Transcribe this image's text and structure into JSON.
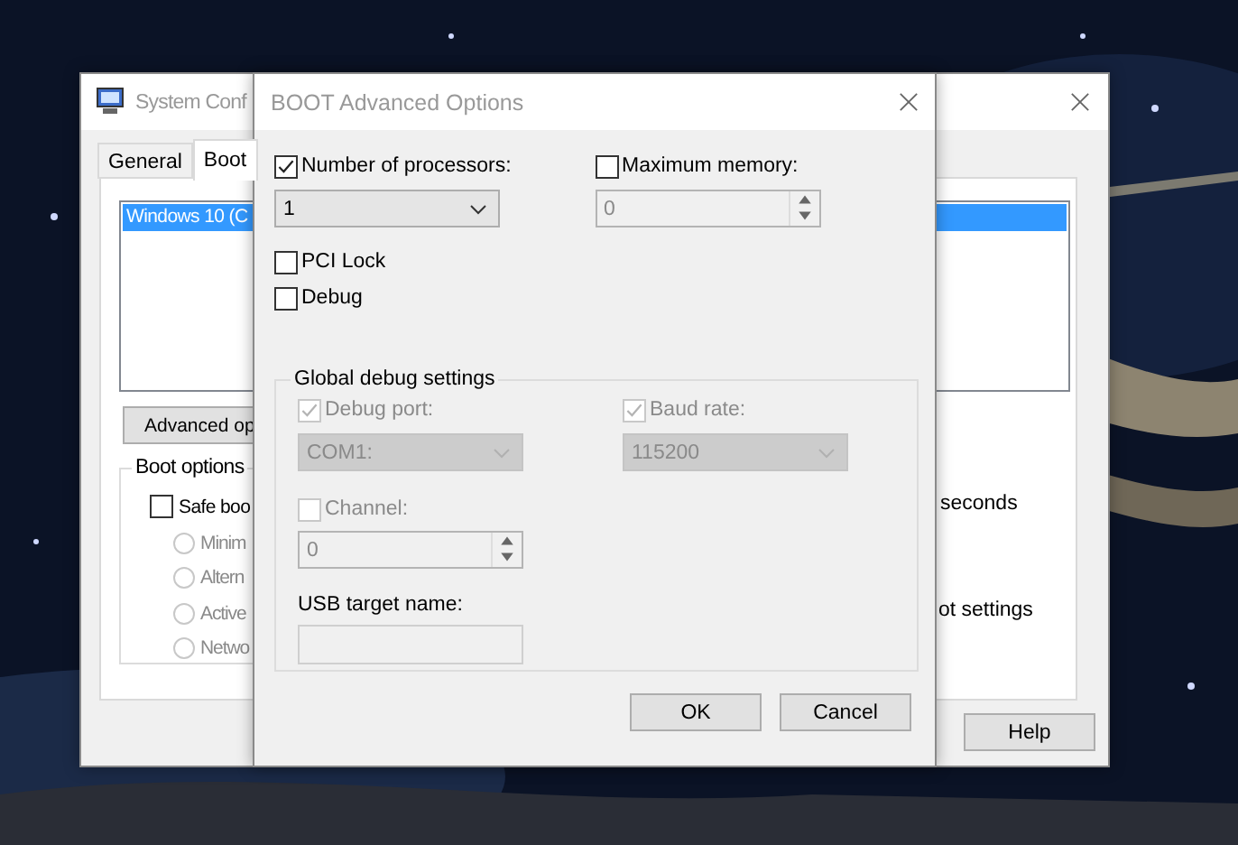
{
  "back_window": {
    "title": "System Conf",
    "tabs": [
      {
        "label": "General",
        "selected": false
      },
      {
        "label": "Boot",
        "selected": true
      }
    ],
    "boot_list": [
      {
        "label": "Windows 10 (C",
        "selected": true
      }
    ],
    "advanced_button": "Advanced op",
    "boot_options": {
      "title": "Boot options",
      "safe_boot": {
        "label": "Safe boo",
        "checked": false
      },
      "modes": [
        {
          "label": "Minim",
          "selected": false,
          "disabled": true
        },
        {
          "label": "Altern",
          "selected": false,
          "disabled": true
        },
        {
          "label": "Active",
          "selected": false,
          "disabled": true
        },
        {
          "label": "Netwo",
          "selected": false,
          "disabled": true
        }
      ]
    },
    "timeout_unit": "seconds",
    "permanent_label": "ot settings",
    "buttons": [
      "Help"
    ]
  },
  "dialog": {
    "title": "BOOT Advanced Options",
    "number_of_processors": {
      "label": "Number of processors:",
      "checked": true,
      "value": "1"
    },
    "maximum_memory": {
      "label": "Maximum memory:",
      "checked": false,
      "disabled": true,
      "value": "0"
    },
    "options": [
      {
        "label": "PCI Lock",
        "checked": false
      },
      {
        "label": "Debug",
        "checked": false
      }
    ],
    "debug_group": {
      "title": "Global debug settings",
      "debug_port": {
        "label": "Debug port:",
        "checked": true,
        "disabled": true,
        "value": "COM1:"
      },
      "baud_rate": {
        "label": "Baud rate:",
        "checked": true,
        "disabled": true,
        "value": "115200"
      },
      "channel": {
        "label": "Channel:",
        "checked": false,
        "disabled": true,
        "value": "0"
      },
      "usb_target_name": {
        "label": "USB target name:",
        "disabled": true
      }
    },
    "buttons": [
      "OK",
      "Cancel"
    ]
  }
}
